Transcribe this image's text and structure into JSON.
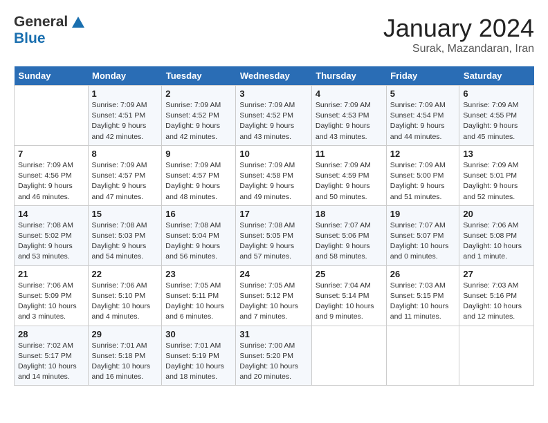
{
  "header": {
    "logo_general": "General",
    "logo_blue": "Blue",
    "month": "January 2024",
    "location": "Surak, Mazandaran, Iran"
  },
  "weekdays": [
    "Sunday",
    "Monday",
    "Tuesday",
    "Wednesday",
    "Thursday",
    "Friday",
    "Saturday"
  ],
  "weeks": [
    [
      {
        "day": "",
        "info": ""
      },
      {
        "day": "1",
        "info": "Sunrise: 7:09 AM\nSunset: 4:51 PM\nDaylight: 9 hours\nand 42 minutes."
      },
      {
        "day": "2",
        "info": "Sunrise: 7:09 AM\nSunset: 4:52 PM\nDaylight: 9 hours\nand 42 minutes."
      },
      {
        "day": "3",
        "info": "Sunrise: 7:09 AM\nSunset: 4:52 PM\nDaylight: 9 hours\nand 43 minutes."
      },
      {
        "day": "4",
        "info": "Sunrise: 7:09 AM\nSunset: 4:53 PM\nDaylight: 9 hours\nand 43 minutes."
      },
      {
        "day": "5",
        "info": "Sunrise: 7:09 AM\nSunset: 4:54 PM\nDaylight: 9 hours\nand 44 minutes."
      },
      {
        "day": "6",
        "info": "Sunrise: 7:09 AM\nSunset: 4:55 PM\nDaylight: 9 hours\nand 45 minutes."
      }
    ],
    [
      {
        "day": "7",
        "info": "Sunrise: 7:09 AM\nSunset: 4:56 PM\nDaylight: 9 hours\nand 46 minutes."
      },
      {
        "day": "8",
        "info": "Sunrise: 7:09 AM\nSunset: 4:57 PM\nDaylight: 9 hours\nand 47 minutes."
      },
      {
        "day": "9",
        "info": "Sunrise: 7:09 AM\nSunset: 4:57 PM\nDaylight: 9 hours\nand 48 minutes."
      },
      {
        "day": "10",
        "info": "Sunrise: 7:09 AM\nSunset: 4:58 PM\nDaylight: 9 hours\nand 49 minutes."
      },
      {
        "day": "11",
        "info": "Sunrise: 7:09 AM\nSunset: 4:59 PM\nDaylight: 9 hours\nand 50 minutes."
      },
      {
        "day": "12",
        "info": "Sunrise: 7:09 AM\nSunset: 5:00 PM\nDaylight: 9 hours\nand 51 minutes."
      },
      {
        "day": "13",
        "info": "Sunrise: 7:09 AM\nSunset: 5:01 PM\nDaylight: 9 hours\nand 52 minutes."
      }
    ],
    [
      {
        "day": "14",
        "info": "Sunrise: 7:08 AM\nSunset: 5:02 PM\nDaylight: 9 hours\nand 53 minutes."
      },
      {
        "day": "15",
        "info": "Sunrise: 7:08 AM\nSunset: 5:03 PM\nDaylight: 9 hours\nand 54 minutes."
      },
      {
        "day": "16",
        "info": "Sunrise: 7:08 AM\nSunset: 5:04 PM\nDaylight: 9 hours\nand 56 minutes."
      },
      {
        "day": "17",
        "info": "Sunrise: 7:08 AM\nSunset: 5:05 PM\nDaylight: 9 hours\nand 57 minutes."
      },
      {
        "day": "18",
        "info": "Sunrise: 7:07 AM\nSunset: 5:06 PM\nDaylight: 9 hours\nand 58 minutes."
      },
      {
        "day": "19",
        "info": "Sunrise: 7:07 AM\nSunset: 5:07 PM\nDaylight: 10 hours\nand 0 minutes."
      },
      {
        "day": "20",
        "info": "Sunrise: 7:06 AM\nSunset: 5:08 PM\nDaylight: 10 hours\nand 1 minute."
      }
    ],
    [
      {
        "day": "21",
        "info": "Sunrise: 7:06 AM\nSunset: 5:09 PM\nDaylight: 10 hours\nand 3 minutes."
      },
      {
        "day": "22",
        "info": "Sunrise: 7:06 AM\nSunset: 5:10 PM\nDaylight: 10 hours\nand 4 minutes."
      },
      {
        "day": "23",
        "info": "Sunrise: 7:05 AM\nSunset: 5:11 PM\nDaylight: 10 hours\nand 6 minutes."
      },
      {
        "day": "24",
        "info": "Sunrise: 7:05 AM\nSunset: 5:12 PM\nDaylight: 10 hours\nand 7 minutes."
      },
      {
        "day": "25",
        "info": "Sunrise: 7:04 AM\nSunset: 5:14 PM\nDaylight: 10 hours\nand 9 minutes."
      },
      {
        "day": "26",
        "info": "Sunrise: 7:03 AM\nSunset: 5:15 PM\nDaylight: 10 hours\nand 11 minutes."
      },
      {
        "day": "27",
        "info": "Sunrise: 7:03 AM\nSunset: 5:16 PM\nDaylight: 10 hours\nand 12 minutes."
      }
    ],
    [
      {
        "day": "28",
        "info": "Sunrise: 7:02 AM\nSunset: 5:17 PM\nDaylight: 10 hours\nand 14 minutes."
      },
      {
        "day": "29",
        "info": "Sunrise: 7:01 AM\nSunset: 5:18 PM\nDaylight: 10 hours\nand 16 minutes."
      },
      {
        "day": "30",
        "info": "Sunrise: 7:01 AM\nSunset: 5:19 PM\nDaylight: 10 hours\nand 18 minutes."
      },
      {
        "day": "31",
        "info": "Sunrise: 7:00 AM\nSunset: 5:20 PM\nDaylight: 10 hours\nand 20 minutes."
      },
      {
        "day": "",
        "info": ""
      },
      {
        "day": "",
        "info": ""
      },
      {
        "day": "",
        "info": ""
      }
    ]
  ]
}
